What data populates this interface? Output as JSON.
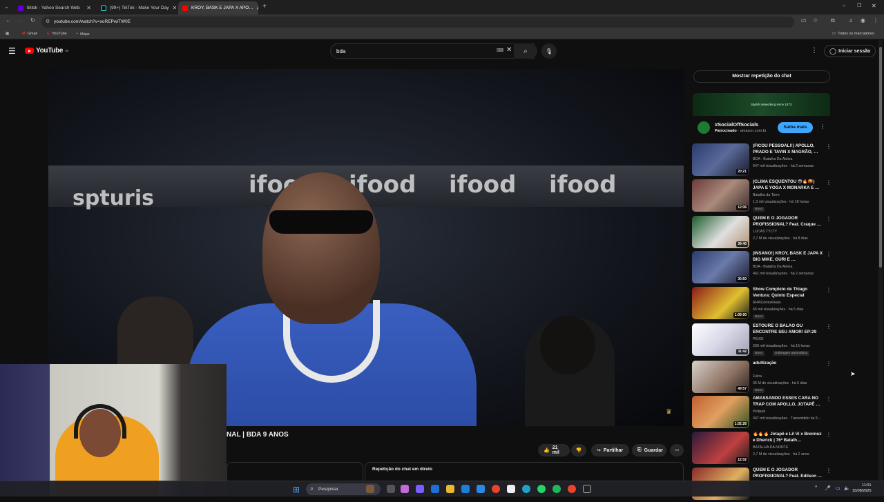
{
  "browser": {
    "tabs": [
      {
        "label": "tiktok - Yahoo Search Web",
        "icon": "yahoo-icon",
        "active": false
      },
      {
        "label": "(99+) TikTok - Make Your Day",
        "icon": "tiktok-icon",
        "active": false
      },
      {
        "label": "KROY, BASK E JAPA X APO…",
        "icon": "youtube-icon",
        "active": true
      }
    ],
    "url": "youtube.com/watch?v=soREPwiTW0E",
    "bookmarks": [
      "Gmail",
      "YouTube",
      "Maps"
    ],
    "all_bookmarks": "Todos os marcadores"
  },
  "youtube": {
    "logo": "YouTube",
    "logo_region": "BR",
    "search_value": "bda",
    "sign_in": "Iniciar sessão"
  },
  "video": {
    "title_visible": "NAL | BDA 9 ANOS",
    "brand_overlay": [
      "ifood",
      "spturis"
    ],
    "like_count": "21 mil",
    "share_label": "Partilhar",
    "save_label": "Guardar"
  },
  "chat_replay": {
    "title": "Repetição do chat em direto",
    "show_button": "Mostrar repetição do chat"
  },
  "ad": {
    "tagline": "Stylish networking since 1873.",
    "headline": "#SocialOffSocials",
    "sponsored": "Patrocinado",
    "domain": "amazon.com.br",
    "cta": "Saiba mais"
  },
  "recommendations": [
    {
      "title": "(FICOU PESSOAL!!) APOLLO, PRADO E TAVIN X MAGRÃO, …",
      "channel": "BDA - Batalha Da Aldeia",
      "meta": "647 mil visualizações · há 2 semanas",
      "duration": "20:21",
      "badge": "",
      "badge2": ""
    },
    {
      "title": "(CLIMA ESQUENTOU 😳🔥🤬) JAPA E YOGA X MONARKA E …",
      "channel": "Batalha da Torre",
      "meta": "1,3 mil visualizações · há 18 horas",
      "duration": "12:06",
      "badge": "Novo",
      "badge2": ""
    },
    {
      "title": "QUEM É O JOGADOR PROFISSIONAL? Feat. Craque …",
      "channel": "LUCAS TYLTY",
      "meta": "2,7 M de visualizações · há 8 dias",
      "duration": "39:40",
      "badge": "",
      "badge2": ""
    },
    {
      "title": "(INSANO!) KROY, BASK E JAPA X BIG MIKE, GURI E …",
      "channel": "BDA - Batalha Da Aldeia",
      "meta": "461 mil visualizações · há 2 semanas",
      "duration": "30:50",
      "badge": "",
      "badge2": ""
    },
    {
      "title": "Show Completo de Thiago Ventura: Quinto Especial",
      "channel": "RHNCortesReais",
      "meta": "65 mil visualizações · há 5 dias",
      "duration": "1:09:00",
      "badge": "Novo",
      "badge2": ""
    },
    {
      "title": "ESTOURE O BALÃO OU ENCONTRE SEU AMOR! EP:29",
      "channel": "PEIXE",
      "meta": "269 mil visualizações · há 15 horas",
      "duration": "31:42",
      "badge": "Novo",
      "badge2": "Dobragem automática"
    },
    {
      "title": "adultização",
      "channel": "Felca",
      "meta": "36 M de visualizações · há 6 dias",
      "duration": "49:57",
      "badge": "Novo",
      "badge2": ""
    },
    {
      "title": "AMASSANDO ESSES CARA NO TRAP COM APOLLO, JOTAPÊ …",
      "channel": "Podpah",
      "meta": "347 mil visualizações · Transmitido há 6…",
      "duration": "1:02:26",
      "badge": "",
      "badge2": ""
    },
    {
      "title": "🔥🔥🔥 Jotapê e Lil Vi x Brennuz e Dherick | 76ª Batalh…",
      "channel": "BATALHA DA NORTE",
      "meta": "2,7 M de visualizações · há 2 anos",
      "duration": "12:02",
      "badge": "",
      "badge2": ""
    },
    {
      "title": "QUEM É O JOGADOR PROFISSIONAL? Feat. Edilson …",
      "channel": "",
      "meta": "",
      "duration": "",
      "badge": "",
      "badge2": ""
    }
  ],
  "taskbar": {
    "search": "Pesquisar",
    "time": "11:01",
    "date": "15/08/2025"
  },
  "colors": {
    "background": "#0f0f0f",
    "youtube_red": "#ff0000",
    "cta_blue": "#3ea6ff"
  }
}
